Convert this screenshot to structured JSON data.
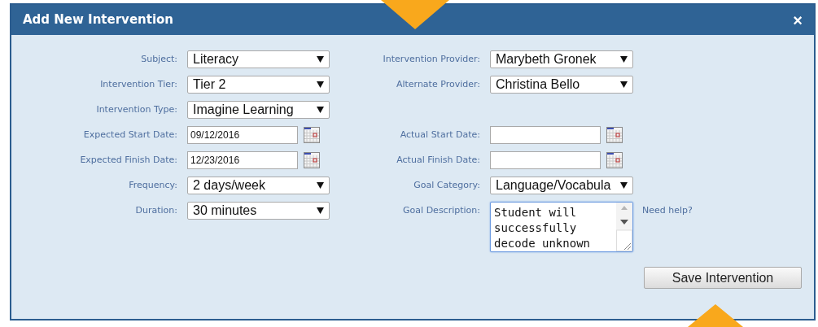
{
  "dialog": {
    "title": "Add New Intervention",
    "close": "×"
  },
  "form": {
    "rows": [
      {
        "left": {
          "label": "Subject:",
          "kind": "select",
          "value": "Literacy"
        },
        "right": {
          "label": "Intervention Provider:",
          "kind": "select",
          "value": "Marybeth Gronek"
        }
      },
      {
        "left": {
          "label": "Intervention Tier:",
          "kind": "select",
          "value": "Tier 2"
        },
        "right": {
          "label": "Alternate Provider:",
          "kind": "select",
          "value": "Christina Bello"
        }
      },
      {
        "left": {
          "label": "Intervention Type:",
          "kind": "select",
          "value": "Imagine Learning"
        }
      },
      {
        "left": {
          "label": "Expected Start Date:",
          "kind": "date",
          "value": "09/12/2016"
        },
        "right": {
          "label": "Actual Start Date:",
          "kind": "date"
        }
      },
      {
        "left": {
          "label": "Expected Finish Date:",
          "kind": "date",
          "value": "12/23/2016"
        },
        "right": {
          "label": "Actual Finish Date:",
          "kind": "date"
        }
      },
      {
        "left": {
          "label": "Frequency:",
          "kind": "select",
          "value": "2 days/week"
        },
        "right": {
          "label": "Goal Category:",
          "kind": "select",
          "value": "Language/Vocabula"
        }
      },
      {
        "left": {
          "label": "Duration:",
          "kind": "select",
          "value": "30 minutes"
        },
        "right": {
          "label": "Goal Description:",
          "kind": "textarea",
          "value": "Student will successfully decode unknown",
          "focused": true,
          "help": "Need help?"
        }
      }
    ]
  },
  "buttons": [
    "Save Intervention"
  ]
}
